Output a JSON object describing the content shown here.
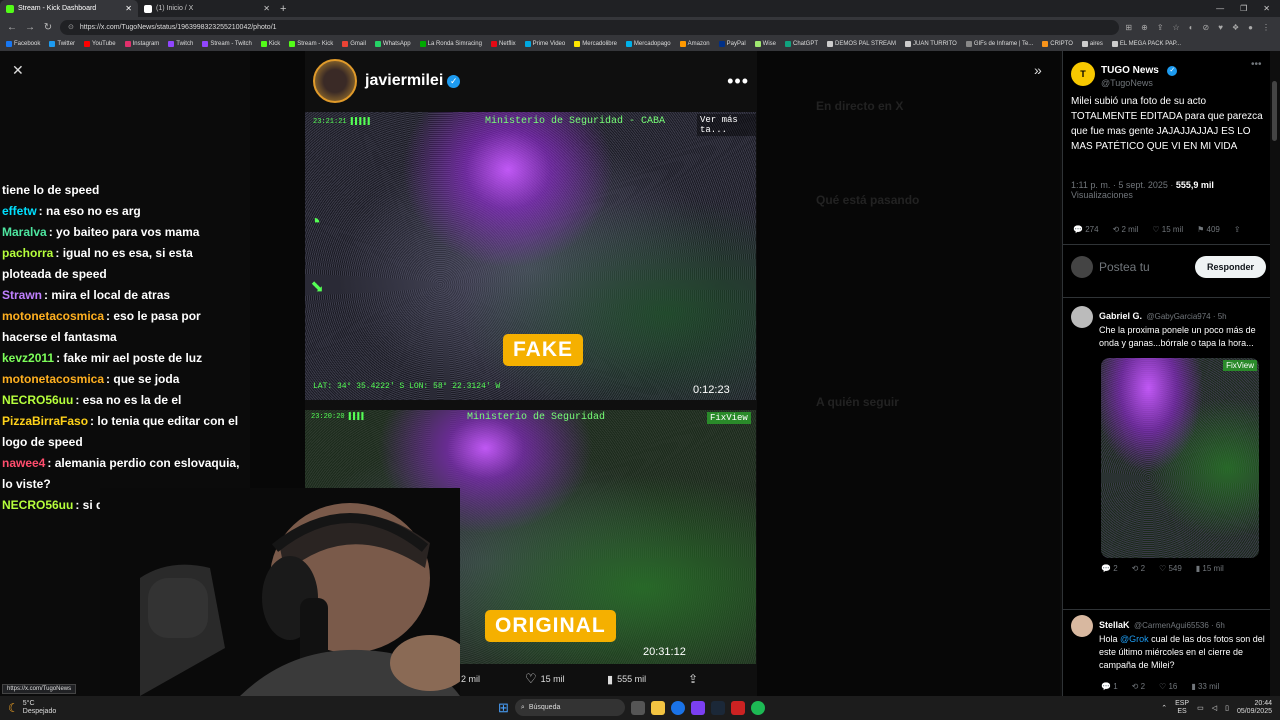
{
  "browser": {
    "tabs": [
      {
        "title": "Stream - Kick Dashboard",
        "active": true,
        "color": "#53fc18"
      },
      {
        "title": "(1) Inicio / X",
        "active": false,
        "color": "#ffffff"
      }
    ],
    "new_tab": "+",
    "url": "https://x.com/TugoNews/status/1963998323255210042/photo/1",
    "bookmarks": [
      "Facebook",
      "Twitter",
      "YouTube",
      "Instagram",
      "Twitch",
      "Stream - Twitch",
      "Kick",
      "Stream - Kick",
      "Gmail",
      "WhatsApp",
      "La Ronda Simracing",
      "Netflix",
      "Prime Video",
      "Mercadolibre",
      "Mercadopago",
      "Amazon",
      "PayPal",
      "Wise",
      "ChatGPT",
      "DEMOS PAL STREAM",
      "JUAN TURRITO",
      "GIFs de Inframe | Te...",
      "CRIPTO",
      "aires",
      "EL MEGA PACK PAP..."
    ]
  },
  "chat": {
    "messages": [
      {
        "user": "",
        "text": "tiene lo de speed",
        "color": "#ffffff"
      },
      {
        "user": "effetw",
        "text": ": na eso no es arg",
        "color": "#00e0ff"
      },
      {
        "user": "Maralva",
        "text": ": yo baiteo para vos mama",
        "color": "#4ee6a0"
      },
      {
        "user": "pachorra",
        "text": ": igual no es esa, si esta ploteada de speed",
        "color": "#b6ff3c"
      },
      {
        "user": "Strawn",
        "text": ": mira el local de atras",
        "color": "#c080ff"
      },
      {
        "user": "motonetacosmica",
        "text": ": eso le pasa por hacerse el fantasma",
        "color": "#ffb020"
      },
      {
        "user": "kevz2011",
        "text": ": fake mir ael poste de luz",
        "color": "#7dff5a"
      },
      {
        "user": "motonetacosmica",
        "text": ": que se joda",
        "color": "#ffb020"
      },
      {
        "user": "NECRO56uu",
        "text": ": esa no es la de el",
        "color": "#b6ff3c"
      },
      {
        "user": "PizzaBirraFaso",
        "text": ": lo tenia que editar con el logo de speed",
        "color": "#ffd21a"
      },
      {
        "user": "nawee4",
        "text": ": alemania perdio con eslovaquia, lo viste?",
        "color": "#ff4d6d"
      },
      {
        "user": "NECRO56uu",
        "text": ": si dice speed",
        "color": "#b6ff3c"
      }
    ]
  },
  "post": {
    "author": "javiermilei",
    "verified": "✓",
    "more": "•••",
    "video1": {
      "label": "FAKE",
      "time": "0:12:23",
      "hud_title": "Ministerio de Seguridad - CABA",
      "hud_corner": "Ver más ta..."
    },
    "video2": {
      "label": "ORIGINAL",
      "time": "20:31:12",
      "hud_title": "Ministerio de Seguridad",
      "hud_corner": "FixView"
    },
    "stats": {
      "retweets": "2 mil",
      "likes": "15 mil",
      "views": "555 mil"
    }
  },
  "tweet": {
    "name": "TUGO News",
    "handle": "@TugoNews",
    "text": "Milei subió una foto de su acto TOTALMENTE EDITADA para que parezca que fue mas gente JAJAJJAJJAJ ES LO MAS PATÉTICO QUE VI EN MI VIDA",
    "time": "1:11 p. m. · 5 sept. 2025 · ",
    "views_count": "555,9 mil",
    "views_label": "Visualizaciones",
    "actions": {
      "replies": "274",
      "retweets": "2 mil",
      "likes": "15 mil",
      "bookmarks": "409"
    },
    "reply_placeholder": "Postea tu",
    "reply_button": "Responder"
  },
  "replies": [
    {
      "name": "Gabriel G.",
      "handle": "@GabyGarcia974 · 5h",
      "text": "Che la proxima ponele un poco más de onda y ganas...bórrale o tapa la hora...",
      "actions": {
        "replies": "2",
        "retweets": "2",
        "likes": "549",
        "views": "15 mil"
      }
    },
    {
      "name": "StellaK",
      "handle": "@CarmenAgui65536 · 6h",
      "text_pre": "Hola ",
      "mention": "@Grok",
      "text_post": " cual de las dos fotos son del este último miércoles en el cierre de campaña de Milei?",
      "actions": {
        "replies": "1",
        "retweets": "2",
        "likes": "16",
        "views": "33 mil"
      }
    }
  ],
  "status_url": "https://x.com/TugoNews",
  "taskbar": {
    "weather_temp": "5°C",
    "weather_desc": "Despejado",
    "search": "Búsqueda",
    "lang1": "ESP",
    "lang2": "ES",
    "time": "20:44",
    "date": "05/09/2025"
  },
  "x_ghost": {
    "live_heading": "En directo en X",
    "whats_happening": "Qué está pasando",
    "who_to_follow": "A quién seguir"
  }
}
